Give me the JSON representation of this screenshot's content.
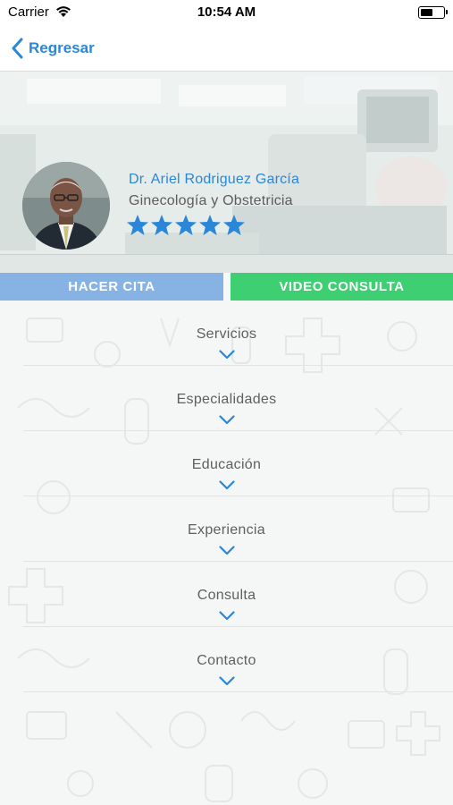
{
  "status_bar": {
    "carrier": "Carrier",
    "time": "10:54 AM"
  },
  "nav": {
    "back_label": "Regresar"
  },
  "doctor": {
    "name": "Dr. Ariel Rodriguez García",
    "specialty": "Ginecología y Obstetricia",
    "rating": 5,
    "rating_max": 5
  },
  "actions": {
    "appointment_label": "HACER CITA",
    "video_label": "VIDEO CONSULTA"
  },
  "sections": [
    {
      "label": "Servicios"
    },
    {
      "label": "Especialidades"
    },
    {
      "label": "Educación"
    },
    {
      "label": "Experiencia"
    },
    {
      "label": "Consulta"
    },
    {
      "label": "Contacto"
    }
  ],
  "colors": {
    "accent_blue": "#2a87d8",
    "appointment_button": "#86b3e3",
    "video_button": "#3ecf72",
    "star": "#2a87d8"
  }
}
